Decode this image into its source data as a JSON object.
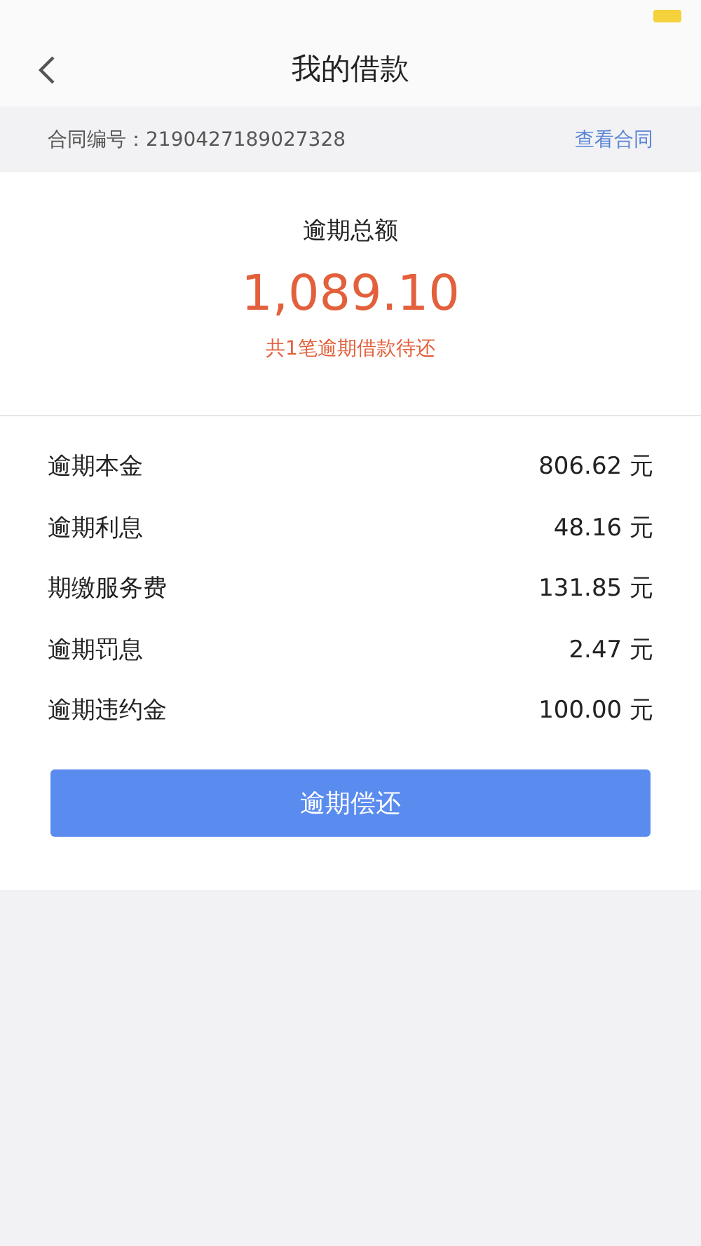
{
  "nav": {
    "title": "我的借款"
  },
  "contract": {
    "label": "合同编号：2190427189027328",
    "link": "查看合同"
  },
  "summary": {
    "title": "逾期总额",
    "amount": "1,089.10",
    "note": "共1笔逾期借款待还"
  },
  "items": [
    {
      "label": "逾期本金",
      "value": "806.62 元"
    },
    {
      "label": "逾期利息",
      "value": "48.16 元"
    },
    {
      "label": "期缴服务费",
      "value": "131.85 元"
    },
    {
      "label": "逾期罚息",
      "value": "2.47 元"
    },
    {
      "label": "逾期违约金",
      "value": "100.00 元"
    }
  ],
  "button": {
    "label": "逾期偿还"
  }
}
